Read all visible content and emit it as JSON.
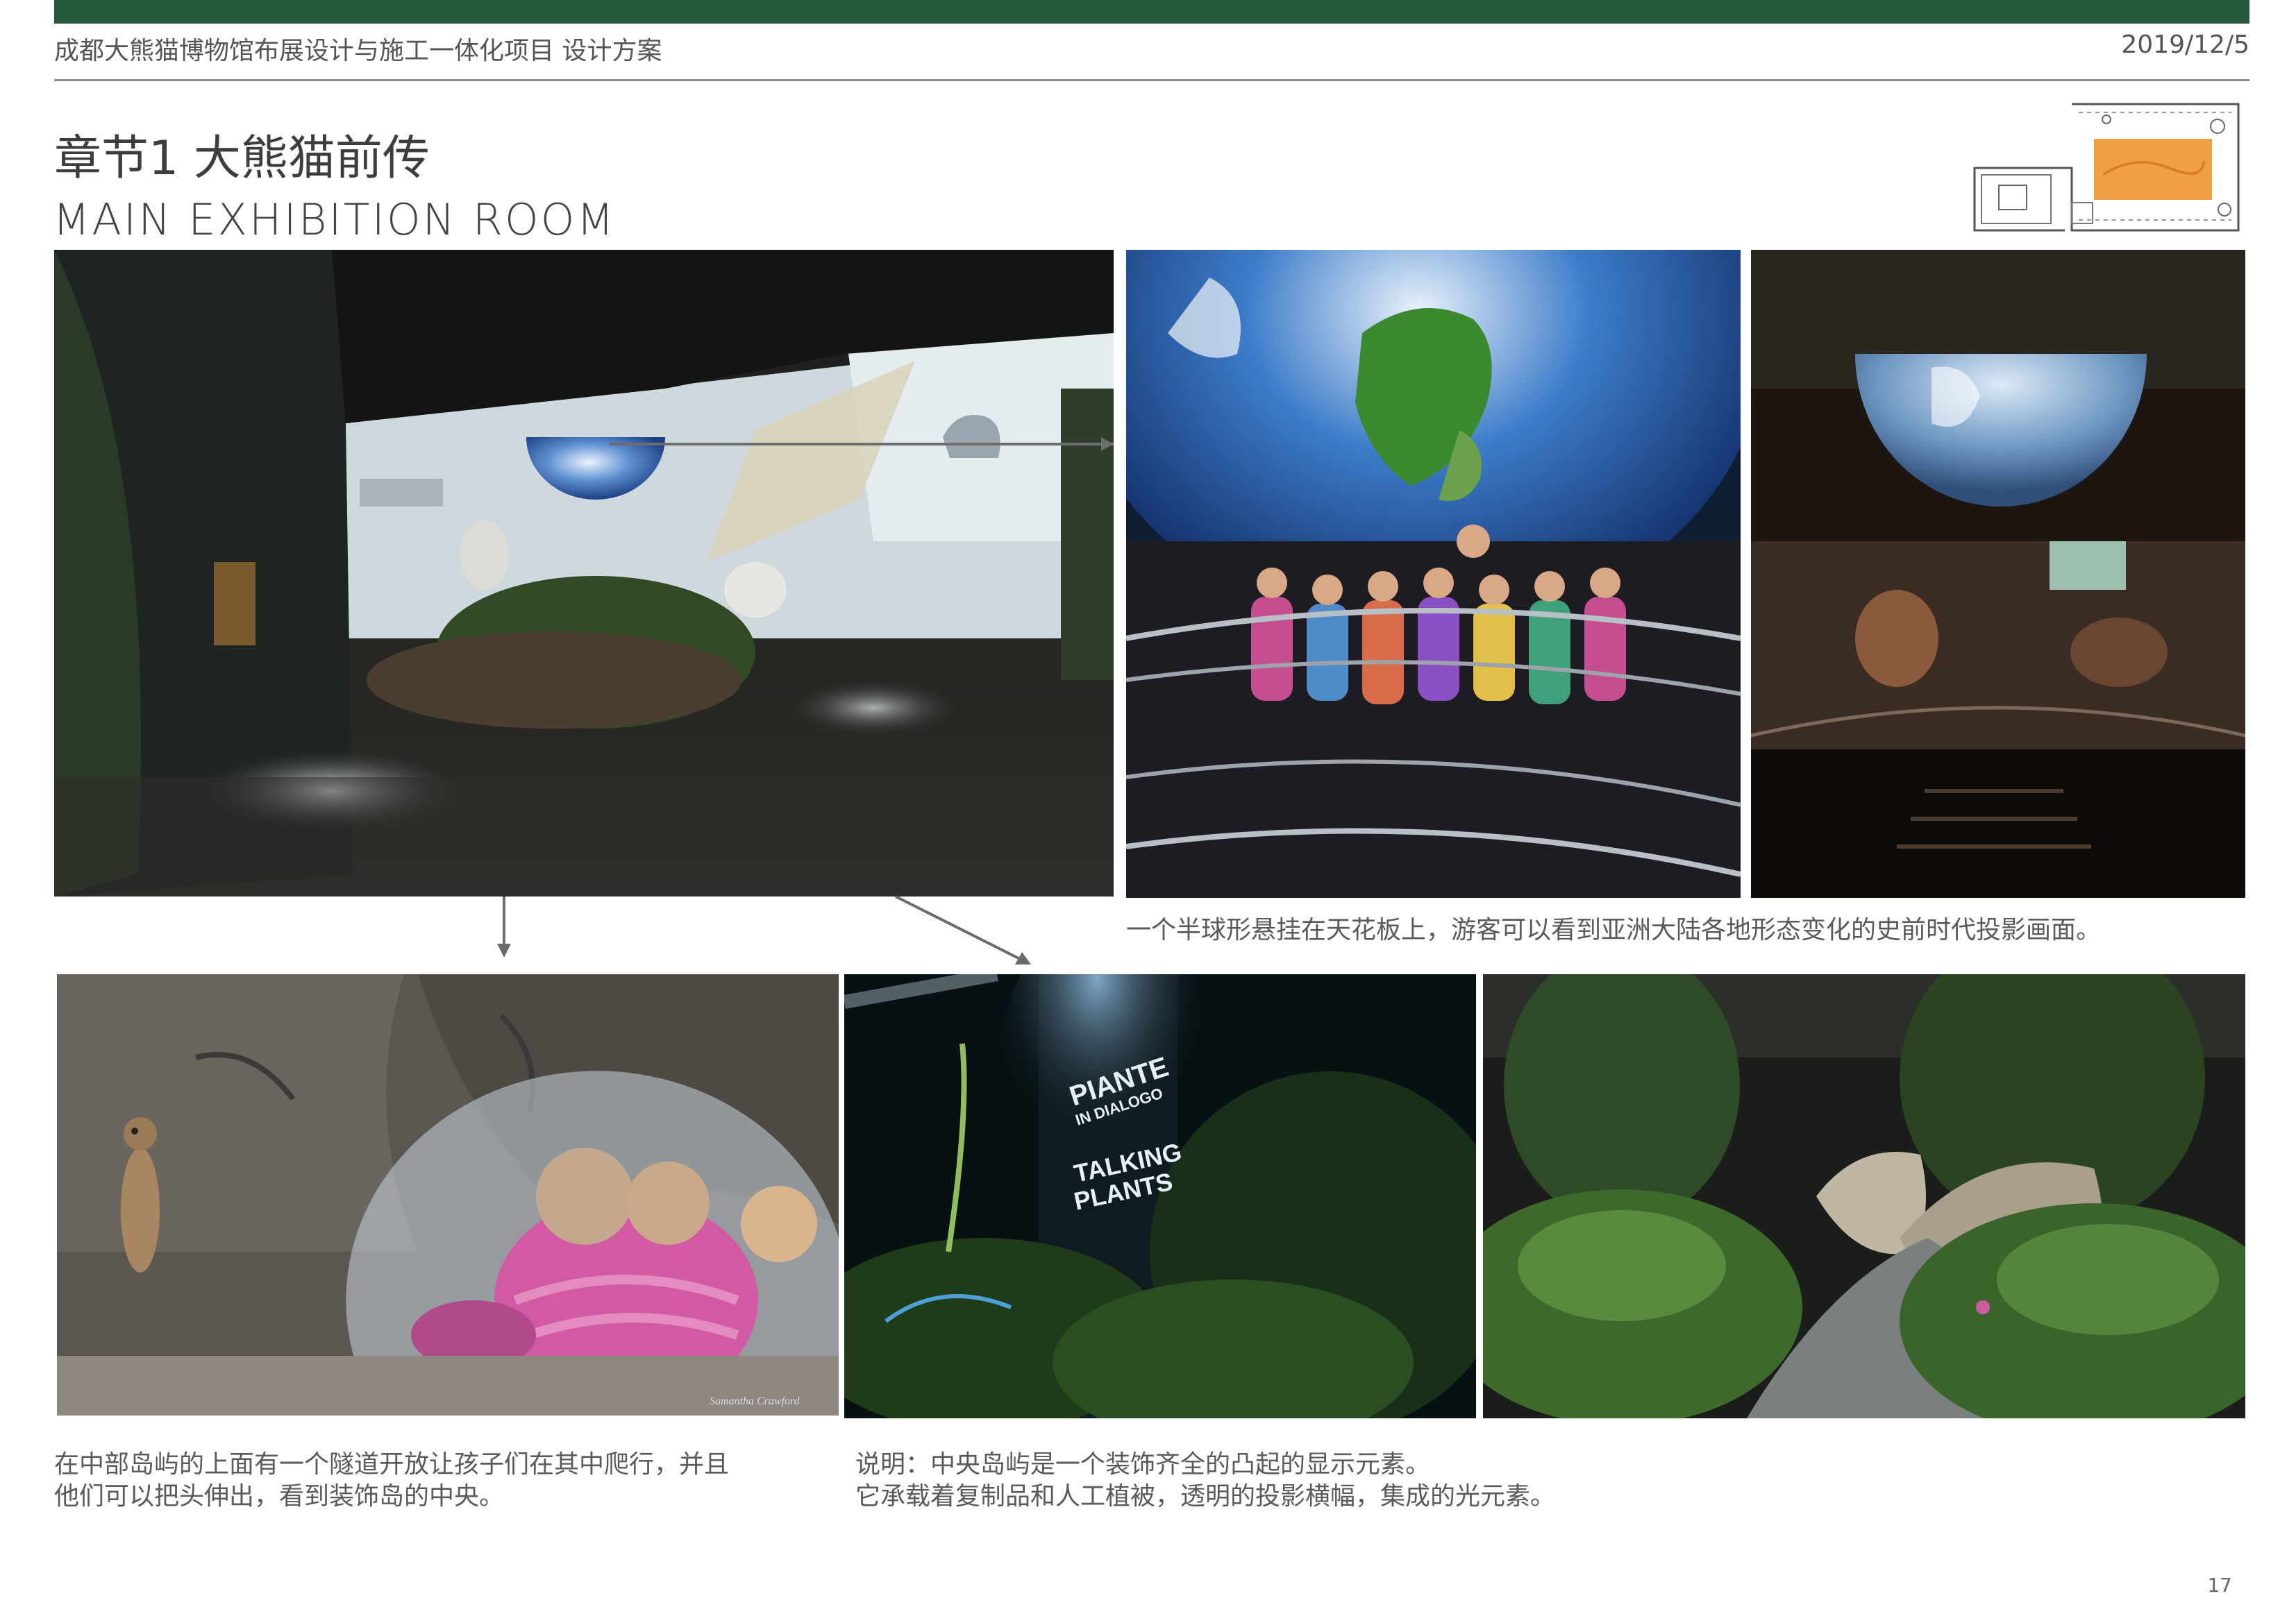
{
  "header": {
    "project_title": "成都大熊猫博物馆布展设计与施工一体化项目  设计方案",
    "date": "2019/12/5"
  },
  "chapter": {
    "title": "章节1 大熊猫前传",
    "subtitle": "MAIN EXHIBITION ROOM"
  },
  "photos": {
    "plant_sign_line1": "PIANTE",
    "plant_sign_line2": "IN DIALOGO",
    "plant_sign_line3": "TALKING",
    "plant_sign_line4": "PLANTS",
    "watermark": "Samantha Crawford"
  },
  "captions": {
    "globe": "一个半球形悬挂在天花板上，游客可以看到亚洲大陆各地形态变化的史前时代投影画面。",
    "tunnel_line1": "在中部岛屿的上面有一个隧道开放让孩子们在其中爬行，并且",
    "tunnel_line2": "他们可以把头伸出，看到装饰岛的中央。",
    "island_line1": "说明：中央岛屿是一个装饰齐全的凸起的显示元素。",
    "island_line2": "它承载着复制品和人工植被，透明的投影横幅，集成的光元素。"
  },
  "page_number": "17"
}
